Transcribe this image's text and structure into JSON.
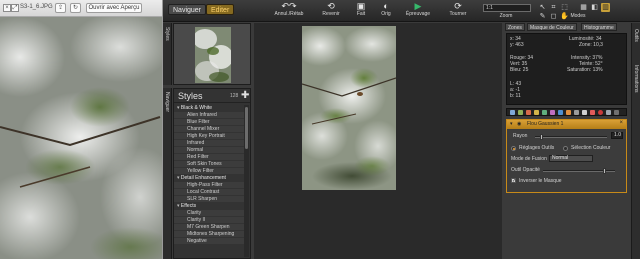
{
  "quicklook": {
    "filename": "S3-1_6.JPG",
    "open_with": "Ouvrir avec Aperçu",
    "icons": [
      "close-icon",
      "fullscreen-icon",
      "share-icon",
      "rotate-icon"
    ]
  },
  "app": {
    "tabs": {
      "navigate": "Naviguer",
      "edit": "Editer"
    },
    "toolbar": [
      {
        "name": "undo",
        "label": "Annul./Rétab",
        "glyph": "↶↷"
      },
      {
        "name": "revert",
        "label": "Revenir",
        "glyph": "⟲"
      },
      {
        "name": "done",
        "label": "Fait",
        "glyph": "▣"
      },
      {
        "name": "original",
        "label": "Orig",
        "glyph": "◐"
      },
      {
        "name": "preview",
        "label": "Épreuvage",
        "glyph": "▶"
      },
      {
        "name": "rotate",
        "label": "Tourner",
        "glyph": "⟳"
      }
    ],
    "zoom": {
      "value": "1:1",
      "label": "Zoom"
    },
    "modes_label": "Modes",
    "side_left_tabs": [
      "Styles",
      "Naviguer"
    ],
    "side_right_tabs": [
      "Outils",
      "Informations"
    ],
    "accent": "#c78a19"
  },
  "styles": {
    "title": "Styles",
    "size_label": "128",
    "categories": [
      {
        "name": "Black & White",
        "items": [
          "Alien Infrared",
          "Blue Filter",
          "Channel Mixer",
          "High Key Portrait",
          "Infrared",
          "Normal",
          "Red Filter",
          "Soft Skin Tones",
          "Yellow Filter"
        ]
      },
      {
        "name": "Detail Enhancement",
        "items": [
          "High-Pass Filter",
          "Local Contrast",
          "SLR Sharpen"
        ]
      },
      {
        "name": "Effects",
        "items": [
          "Clarity",
          "Clarity II",
          "M7 Green Sharpen",
          "Midtones Sharpening",
          "Negative"
        ]
      }
    ]
  },
  "right_panel": {
    "tabs": [
      "Zones",
      "Masque de Couleur",
      "Histogramme"
    ],
    "info": {
      "x": "x: 34",
      "y": "y: 463",
      "lum": "Luminosité: 34",
      "zone": "Zone: 10,3",
      "rouge": "Rouge: 34",
      "vert": "Vert: 35",
      "bleu": "Bleu: 25",
      "intensity": "Intensity: 37%",
      "teinte": "Teinte: 52°",
      "saturation": "Saturation: 13%",
      "l": "L: 43",
      "a": "a: -1",
      "b": "b: 11"
    },
    "layer": {
      "title": "Flou Gaussien 1",
      "radius_label": "Rayon",
      "radius_value": "1.0",
      "radius_fraction": 0.08,
      "settings_label": "Réglages Outils",
      "color_select_label": "Sélection Couleur",
      "blend_label": "Mode de Fusion",
      "blend_value": "Normal",
      "opacity_label": "Outil Opacité",
      "opacity_fraction": 0.88,
      "invert_label": "Inverser le Masque"
    }
  }
}
